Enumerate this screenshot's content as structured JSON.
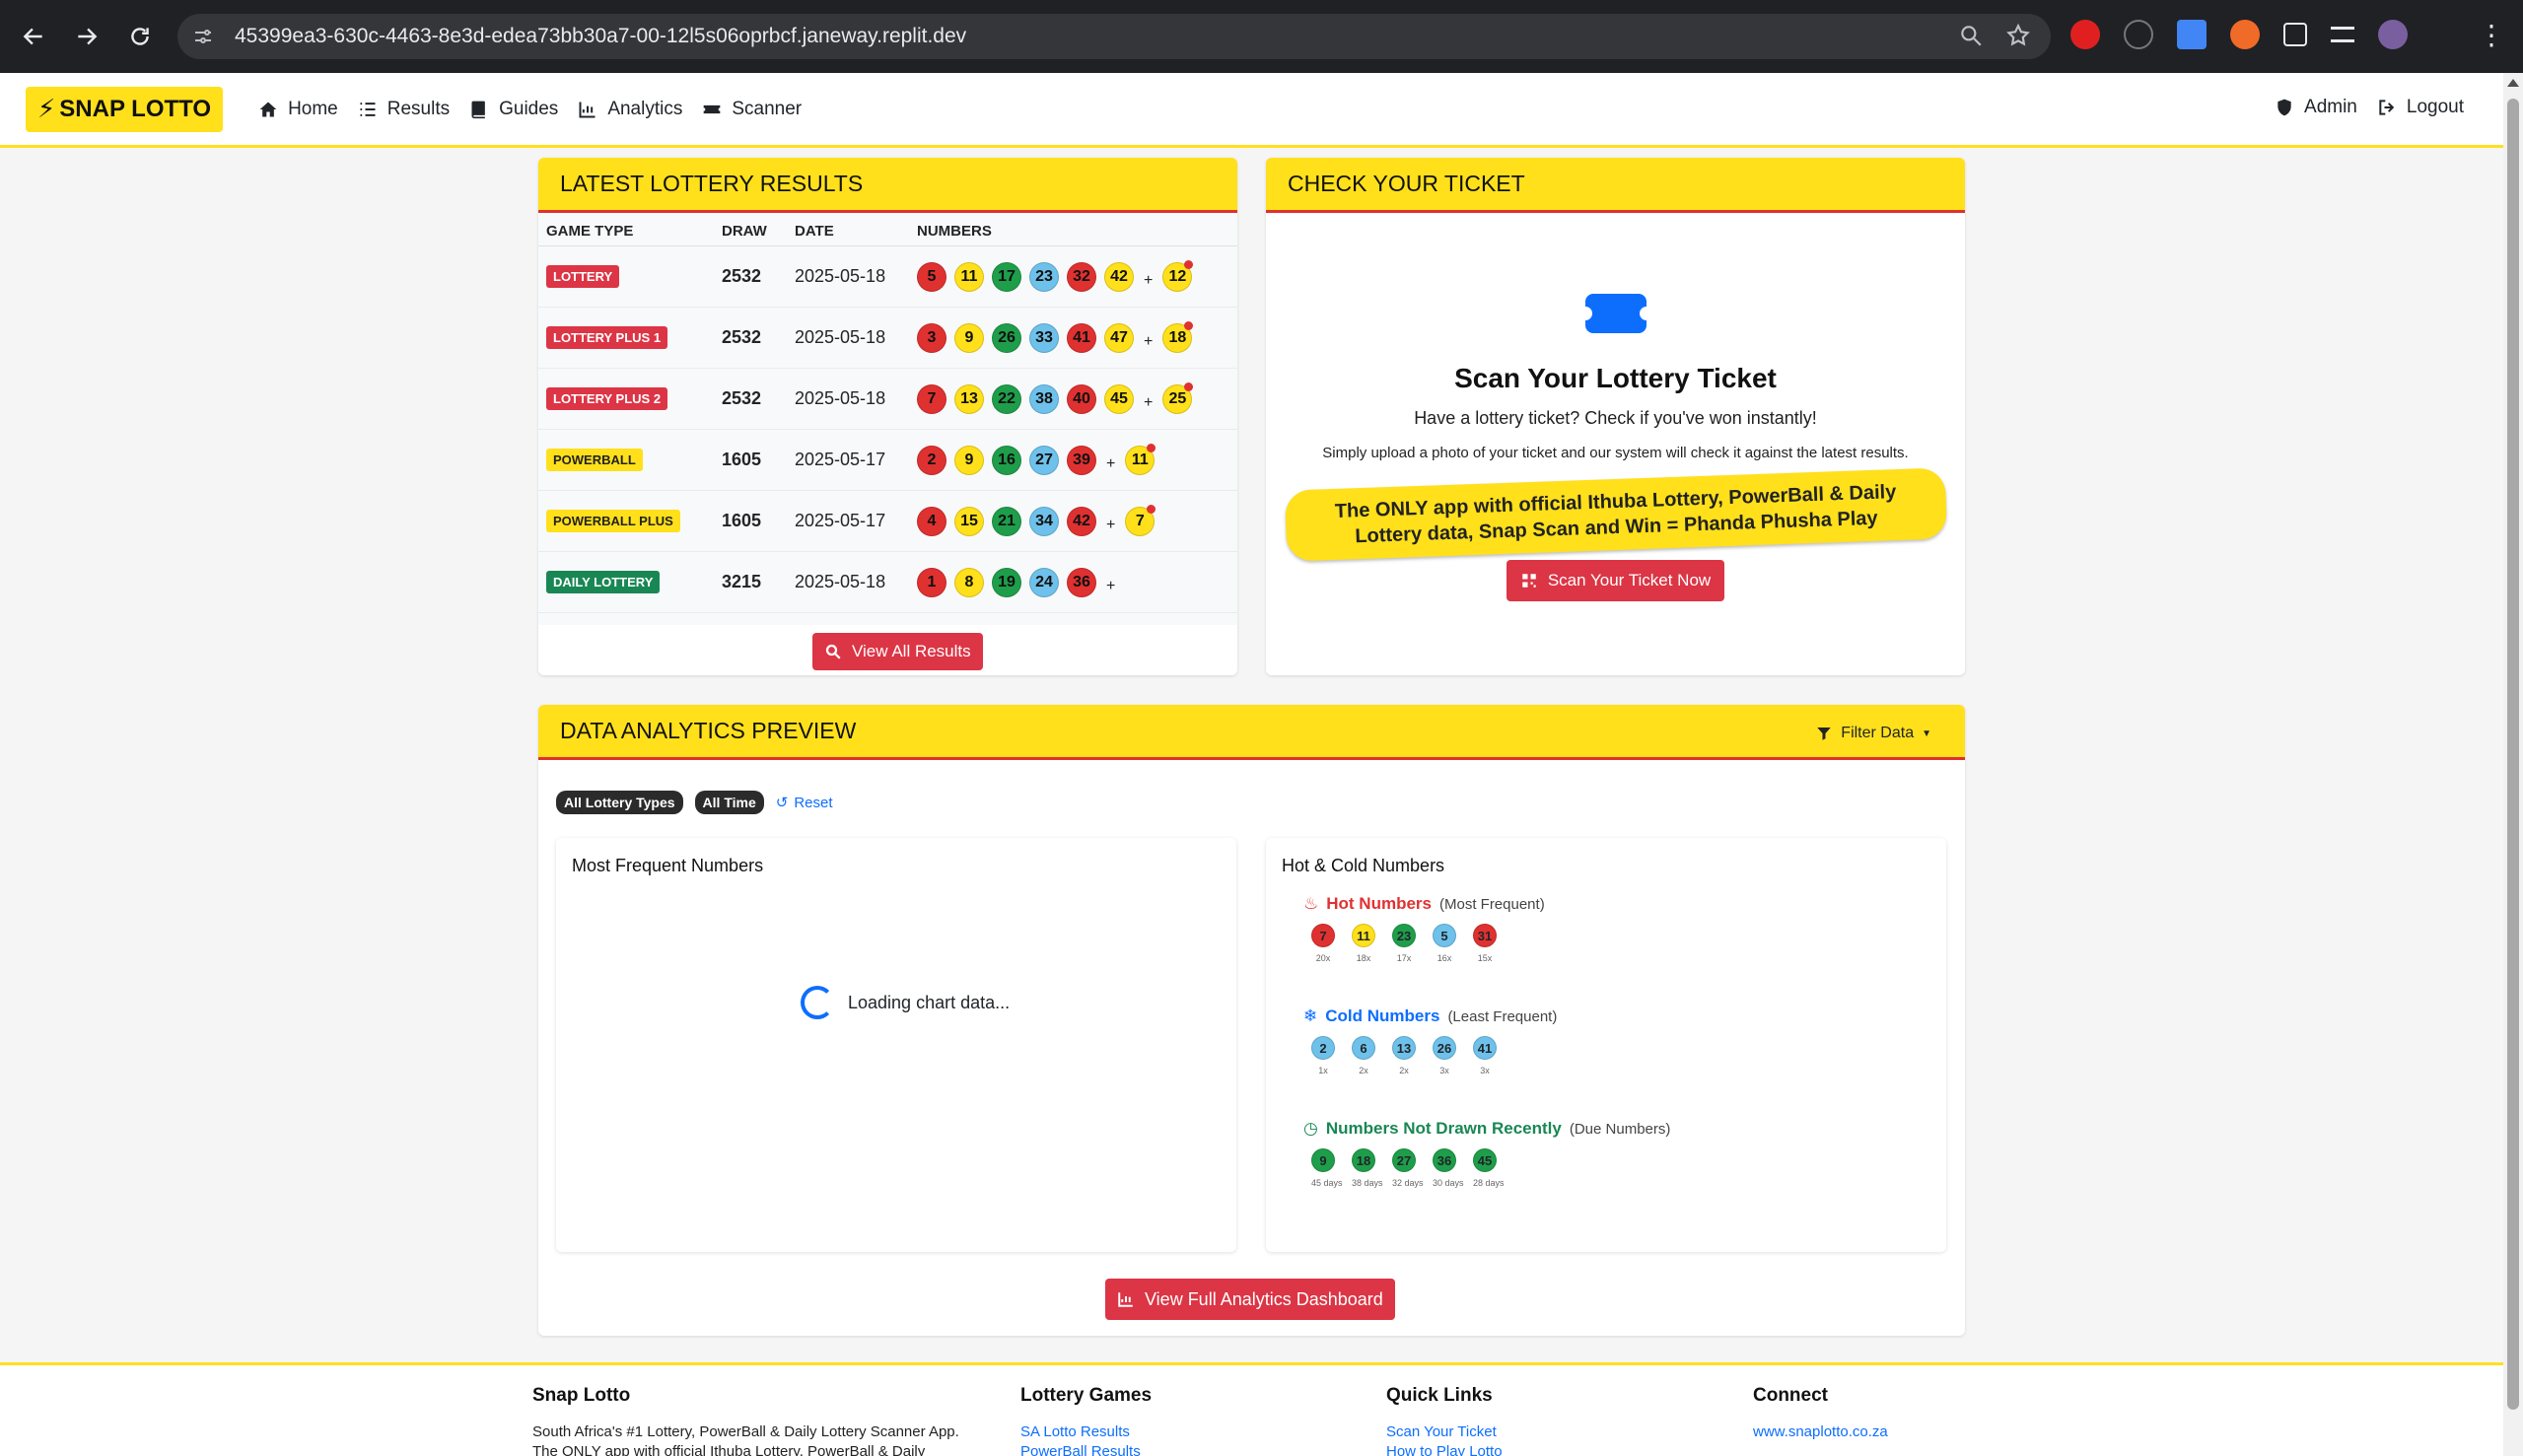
{
  "browser": {
    "url": "45399ea3-630c-4463-8e3d-edea73bb30a7-00-12l5s06oprbcf.janeway.replit.dev"
  },
  "nav": {
    "brand": "SNAP LOTTO",
    "links": [
      "Home",
      "Results",
      "Guides",
      "Analytics",
      "Scanner"
    ],
    "admin": "Admin",
    "logout": "Logout"
  },
  "latest": {
    "title": "LATEST LOTTERY RESULTS",
    "headers": [
      "GAME TYPE",
      "DRAW",
      "DATE",
      "NUMBERS"
    ],
    "rows": [
      {
        "game": "LOTTERY",
        "badge": "red",
        "draw": "2532",
        "date": "2025-05-18",
        "numbers": [
          [
            "5",
            "red"
          ],
          [
            "11",
            "yellow"
          ],
          [
            "17",
            "green"
          ],
          [
            "23",
            "blue"
          ],
          [
            "32",
            "red"
          ],
          [
            "42",
            "yellow"
          ]
        ],
        "bonus": [
          "12",
          "yellow"
        ]
      },
      {
        "game": "LOTTERY PLUS 1",
        "badge": "red",
        "draw": "2532",
        "date": "2025-05-18",
        "numbers": [
          [
            "3",
            "red"
          ],
          [
            "9",
            "yellow"
          ],
          [
            "26",
            "green"
          ],
          [
            "33",
            "blue"
          ],
          [
            "41",
            "red"
          ],
          [
            "47",
            "yellow"
          ]
        ],
        "bonus": [
          "18",
          "yellow"
        ]
      },
      {
        "game": "LOTTERY PLUS 2",
        "badge": "red",
        "draw": "2532",
        "date": "2025-05-18",
        "numbers": [
          [
            "7",
            "red"
          ],
          [
            "13",
            "yellow"
          ],
          [
            "22",
            "green"
          ],
          [
            "38",
            "blue"
          ],
          [
            "40",
            "red"
          ],
          [
            "45",
            "yellow"
          ]
        ],
        "bonus": [
          "25",
          "yellow"
        ]
      },
      {
        "game": "POWERBALL",
        "badge": "yellow",
        "draw": "1605",
        "date": "2025-05-17",
        "numbers": [
          [
            "2",
            "red"
          ],
          [
            "9",
            "yellow"
          ],
          [
            "16",
            "green"
          ],
          [
            "27",
            "blue"
          ],
          [
            "39",
            "red"
          ]
        ],
        "bonus": [
          "11",
          "yellow"
        ]
      },
      {
        "game": "POWERBALL PLUS",
        "badge": "yellow",
        "draw": "1605",
        "date": "2025-05-17",
        "numbers": [
          [
            "4",
            "red"
          ],
          [
            "15",
            "yellow"
          ],
          [
            "21",
            "green"
          ],
          [
            "34",
            "blue"
          ],
          [
            "42",
            "red"
          ]
        ],
        "bonus": [
          "7",
          "yellow"
        ]
      },
      {
        "game": "DAILY LOTTERY",
        "badge": "green",
        "draw": "3215",
        "date": "2025-05-18",
        "numbers": [
          [
            "1",
            "red"
          ],
          [
            "8",
            "yellow"
          ],
          [
            "19",
            "green"
          ],
          [
            "24",
            "blue"
          ],
          [
            "36",
            "red"
          ]
        ],
        "bonus": null
      }
    ],
    "view_all": "View All Results"
  },
  "ticket": {
    "title": "CHECK YOUR TICKET",
    "heading": "Scan Your Lottery Ticket",
    "sub": "Have a lottery ticket? Check if you've won instantly!",
    "small": "Simply upload a photo of your ticket and our system will check it against the latest results.",
    "promo": "The ONLY app with official Ithuba Lottery, PowerBall & Daily Lottery data, Snap Scan and Win = Phanda Phusha Play",
    "button": "Scan Your Ticket Now"
  },
  "analytics": {
    "title": "DATA ANALYTICS PREVIEW",
    "filter": "Filter Data",
    "chips": [
      "All Lottery Types",
      "All Time"
    ],
    "reset": "Reset",
    "most_frequent": "Most Frequent Numbers",
    "loading": "Loading chart data...",
    "hot_cold_title": "Hot & Cold Numbers",
    "hot": {
      "title": "Hot Numbers",
      "paren": "(Most Frequent)",
      "color": "#e03131",
      "items": [
        [
          "7",
          "red",
          "20x"
        ],
        [
          "11",
          "yellow",
          "18x"
        ],
        [
          "23",
          "green",
          "17x"
        ],
        [
          "5",
          "blue",
          "16x"
        ],
        [
          "31",
          "red",
          "15x"
        ]
      ]
    },
    "cold": {
      "title": "Cold Numbers",
      "paren": "(Least Frequent)",
      "color": "#0d6efd",
      "items": [
        [
          "2",
          "blue",
          "1x"
        ],
        [
          "6",
          "blue",
          "2x"
        ],
        [
          "13",
          "blue",
          "2x"
        ],
        [
          "26",
          "blue",
          "3x"
        ],
        [
          "41",
          "blue",
          "3x"
        ]
      ]
    },
    "due": {
      "title": "Numbers Not Drawn Recently",
      "paren": "(Due Numbers)",
      "color": "#198754",
      "items": [
        [
          "9",
          "green",
          "45 days"
        ],
        [
          "18",
          "green",
          "38 days"
        ],
        [
          "27",
          "green",
          "32 days"
        ],
        [
          "36",
          "green",
          "30 days"
        ],
        [
          "45",
          "green",
          "28 days"
        ]
      ]
    },
    "full_button": "View Full Analytics Dashboard"
  },
  "footer": {
    "col1": {
      "title": "Snap Lotto",
      "text": "South Africa's #1 Lottery, PowerBall & Daily Lottery Scanner App.",
      "text2": "The ONLY app with official Ithuba Lottery, PowerBall & Daily"
    },
    "col2": {
      "title": "Lottery Games",
      "links": [
        "SA Lotto Results",
        "PowerBall Results"
      ]
    },
    "col3": {
      "title": "Quick Links",
      "links": [
        "Scan Your Ticket",
        "How to Play Lotto"
      ]
    },
    "col4": {
      "title": "Connect",
      "links": [
        "www.snaplotto.co.za"
      ]
    }
  }
}
